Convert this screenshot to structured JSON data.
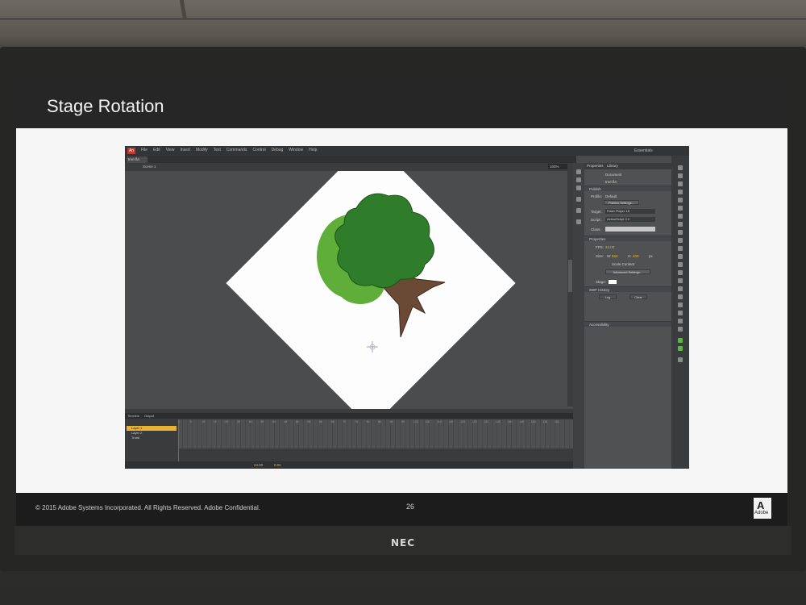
{
  "slide": {
    "title": "Stage Rotation",
    "copyright": "© 2015 Adobe Systems Incorporated.  All Rights Reserved.  Adobe Confidential.",
    "page_number": "26",
    "adobe_logo": "Adobe"
  },
  "monitor": {
    "brand": "NEC"
  },
  "app": {
    "logo": "An",
    "menu": [
      "File",
      "Edit",
      "View",
      "Insert",
      "Modify",
      "Text",
      "Commands",
      "Control",
      "Debug",
      "Window",
      "Help"
    ],
    "workspace": "Essentials",
    "doc_tab": "tree.fla",
    "scene": "Scene 1",
    "zoom": "100%"
  },
  "timeline": {
    "tabs": [
      "Timeline",
      "Output"
    ],
    "layers": [
      "Layer 1",
      "Layer 2",
      "Trunk"
    ],
    "frame_numbers": [
      "1",
      "5",
      "10",
      "15",
      "20",
      "25",
      "30",
      "35",
      "40",
      "45",
      "50",
      "55",
      "60",
      "65",
      "70",
      "75",
      "80",
      "85",
      "90",
      "95",
      "100",
      "105",
      "110",
      "115",
      "120",
      "125",
      "130",
      "135",
      "140",
      "145",
      "150",
      "155",
      "160"
    ],
    "fps": "24.00",
    "fps_label": "fps",
    "time": "0.0s"
  },
  "properties": {
    "tabs": [
      "Properties",
      "Library"
    ],
    "doc_type": "Document",
    "doc_name": "tree.fla",
    "publish_section": "Publish",
    "profile_label": "Profile:",
    "profile_value": "Default",
    "publish_settings": "Publish Settings...",
    "target_label": "Target:",
    "target_value": "Flash Player 18",
    "script_label": "Script:",
    "script_value": "ActionScript 3.0",
    "class_label": "Class:",
    "props_section": "Properties",
    "fps_label": "FPS:",
    "fps_value": "24.00",
    "size_label": "Size:",
    "w_label": "W:",
    "w_value": "550",
    "h_label": "H:",
    "h_value": "400",
    "px_label": "px",
    "scale_content": "Scale Content",
    "advanced_settings": "Advanced Settings...",
    "stage_label": "Stage:",
    "swf_history": "SWF History",
    "log_btn": "Log",
    "clear_btn": "Clear",
    "accessibility": "Accessibility"
  },
  "colors": {
    "tree_leaves": "#2f7d2a",
    "tree_leaves_light": "#5fae3a",
    "trunk": "#6b4a35",
    "layer_active": "#e8b133",
    "playhead": "#e23b2e"
  }
}
